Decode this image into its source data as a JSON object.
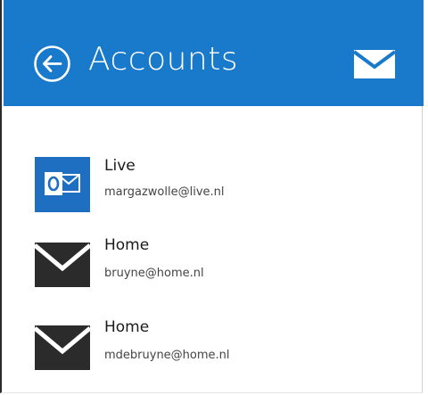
{
  "header": {
    "title": "Accounts",
    "back_icon": "back-arrow-circle-icon",
    "mail_icon": "envelope-icon",
    "background_color": "#1979ca",
    "text_color": "#ffffff"
  },
  "accounts": [
    {
      "name": "Live",
      "email": "margazwolle@live.nl",
      "icon": "outlook-icon",
      "icon_color": "#1e6fc1"
    },
    {
      "name": "Home",
      "email": "bruyne@home.nl",
      "icon": "envelope-icon",
      "icon_color": "#2b2b2b"
    },
    {
      "name": "Home",
      "email": "mdebruyne@home.nl",
      "icon": "envelope-icon",
      "icon_color": "#2b2b2b"
    }
  ]
}
